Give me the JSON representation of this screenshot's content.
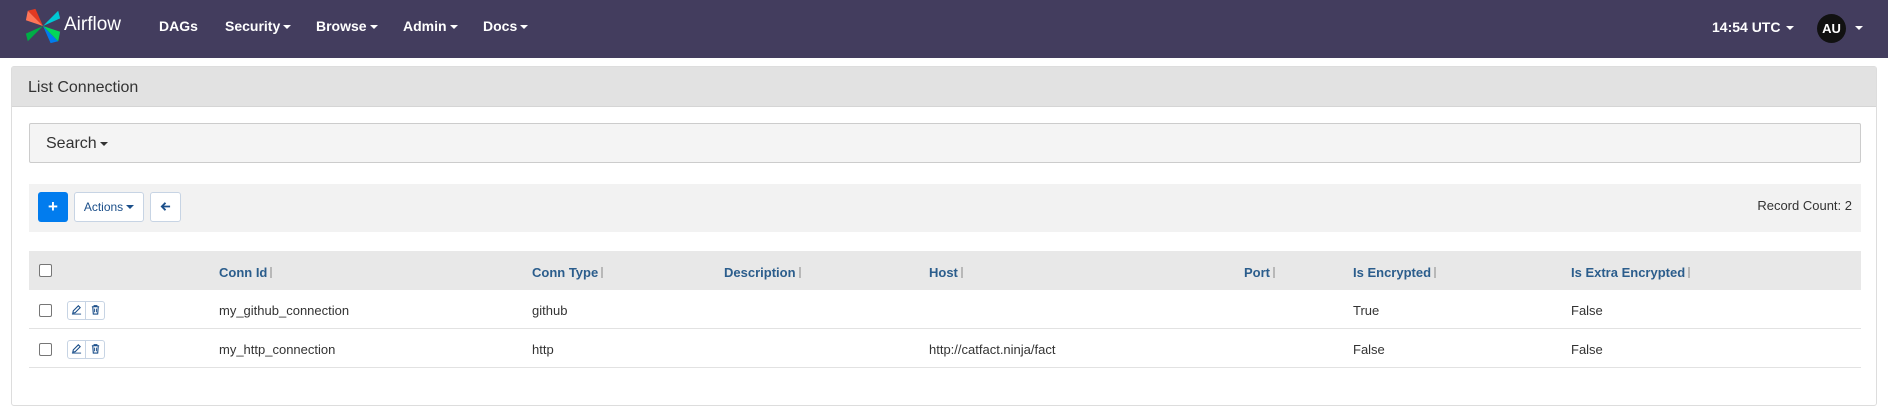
{
  "navbar": {
    "brand": "Airflow",
    "items": [
      {
        "label": "DAGs",
        "dropdown": false
      },
      {
        "label": "Security",
        "dropdown": true
      },
      {
        "label": "Browse",
        "dropdown": true
      },
      {
        "label": "Admin",
        "dropdown": true
      },
      {
        "label": "Docs",
        "dropdown": true
      }
    ],
    "clock": "14:54 UTC",
    "avatar": "AU"
  },
  "panel": {
    "title": "List Connection",
    "search_label": "Search",
    "actions_label": "Actions",
    "add_icon": "plus-icon",
    "back_icon": "arrow-left-icon",
    "record_count": "Record Count: 2"
  },
  "table": {
    "columns": [
      "Conn Id",
      "Conn Type",
      "Description",
      "Host",
      "Port",
      "Is Encrypted",
      "Is Extra Encrypted"
    ],
    "rows": [
      {
        "conn_id": "my_github_connection",
        "conn_type": "github",
        "description": "",
        "host": "",
        "port": "",
        "is_encrypted": "True",
        "is_extra_encrypted": "False"
      },
      {
        "conn_id": "my_http_connection",
        "conn_type": "http",
        "description": "",
        "host": "http://catfact.ninja/fact",
        "port": "",
        "is_encrypted": "False",
        "is_extra_encrypted": "False"
      }
    ]
  },
  "colors": {
    "navbar_bg": "#433d5e",
    "primary": "#017cee",
    "link": "#2b5d8c"
  }
}
